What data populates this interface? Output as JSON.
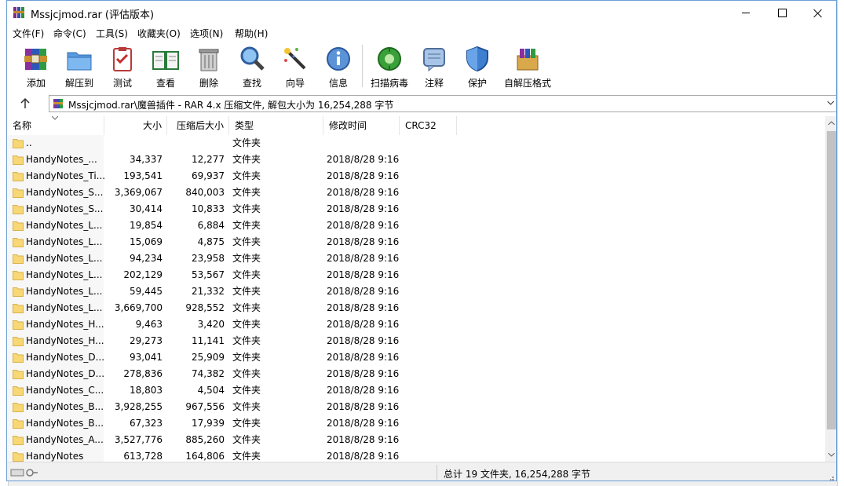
{
  "window": {
    "title": "Mssjcjmod.rar (评估版本)"
  },
  "menu": [
    "文件(F)",
    "命令(C)",
    "工具(S)",
    "收藏夹(O)",
    "选项(N)",
    "帮助(H)"
  ],
  "toolbar": {
    "add": "添加",
    "extract": "解压到",
    "test": "测试",
    "view": "查看",
    "delete": "删除",
    "find": "查找",
    "wizard": "向导",
    "info": "信息",
    "virus_scan": "扫描病毒",
    "comment": "注释",
    "protect": "保护",
    "sfx": "自解压格式"
  },
  "address": {
    "path": "Mssjcjmod.rar\\魔兽插件 - RAR 4.x 压缩文件, 解包大小为 16,254,288 字节"
  },
  "columns": {
    "name": "名称",
    "size": "大小",
    "packed": "压缩后大小",
    "type": "类型",
    "modified": "修改时间",
    "crc": "CRC32"
  },
  "rows": [
    {
      "name": "..",
      "size": "",
      "packed": "",
      "type": "文件夹",
      "modified": ""
    },
    {
      "name": "HandyNotes_...",
      "size": "34,337",
      "packed": "12,277",
      "type": "文件夹",
      "modified": "2018/8/28 9:16"
    },
    {
      "name": "HandyNotes_Ti...",
      "size": "193,541",
      "packed": "69,937",
      "type": "文件夹",
      "modified": "2018/8/28 9:16"
    },
    {
      "name": "HandyNotes_S...",
      "size": "3,369,067",
      "packed": "840,003",
      "type": "文件夹",
      "modified": "2018/8/28 9:16"
    },
    {
      "name": "HandyNotes_S...",
      "size": "30,414",
      "packed": "10,833",
      "type": "文件夹",
      "modified": "2018/8/28 9:16"
    },
    {
      "name": "HandyNotes_L...",
      "size": "19,854",
      "packed": "6,884",
      "type": "文件夹",
      "modified": "2018/8/28 9:16"
    },
    {
      "name": "HandyNotes_L...",
      "size": "15,069",
      "packed": "4,875",
      "type": "文件夹",
      "modified": "2018/8/28 9:16"
    },
    {
      "name": "HandyNotes_L...",
      "size": "94,234",
      "packed": "23,958",
      "type": "文件夹",
      "modified": "2018/8/28 9:16"
    },
    {
      "name": "HandyNotes_L...",
      "size": "202,129",
      "packed": "53,567",
      "type": "文件夹",
      "modified": "2018/8/28 9:16"
    },
    {
      "name": "HandyNotes_L...",
      "size": "59,445",
      "packed": "21,332",
      "type": "文件夹",
      "modified": "2018/8/28 9:16"
    },
    {
      "name": "HandyNotes_L...",
      "size": "3,669,700",
      "packed": "928,552",
      "type": "文件夹",
      "modified": "2018/8/28 9:16"
    },
    {
      "name": "HandyNotes_H...",
      "size": "9,463",
      "packed": "3,420",
      "type": "文件夹",
      "modified": "2018/8/28 9:16"
    },
    {
      "name": "HandyNotes_H...",
      "size": "29,273",
      "packed": "11,141",
      "type": "文件夹",
      "modified": "2018/8/28 9:16"
    },
    {
      "name": "HandyNotes_D...",
      "size": "93,041",
      "packed": "25,909",
      "type": "文件夹",
      "modified": "2018/8/28 9:16"
    },
    {
      "name": "HandyNotes_D...",
      "size": "278,836",
      "packed": "74,382",
      "type": "文件夹",
      "modified": "2018/8/28 9:16"
    },
    {
      "name": "HandyNotes_C...",
      "size": "18,803",
      "packed": "4,504",
      "type": "文件夹",
      "modified": "2018/8/28 9:16"
    },
    {
      "name": "HandyNotes_B...",
      "size": "3,928,255",
      "packed": "967,556",
      "type": "文件夹",
      "modified": "2018/8/28 9:16"
    },
    {
      "name": "HandyNotes_B...",
      "size": "67,323",
      "packed": "17,939",
      "type": "文件夹",
      "modified": "2018/8/28 9:16"
    },
    {
      "name": "HandyNotes_A...",
      "size": "3,527,776",
      "packed": "885,260",
      "type": "文件夹",
      "modified": "2018/8/28 9:16"
    },
    {
      "name": "HandyNotes",
      "size": "613,728",
      "packed": "164,806",
      "type": "文件夹",
      "modified": "2018/8/28 9:16"
    }
  ],
  "status": {
    "summary": "总计 19 文件夹, 16,254,288 字节"
  },
  "colors": {
    "window_border": "#6b9fd6",
    "folder": "#f8d775",
    "scroll_thumb": "#c2c2c2"
  }
}
